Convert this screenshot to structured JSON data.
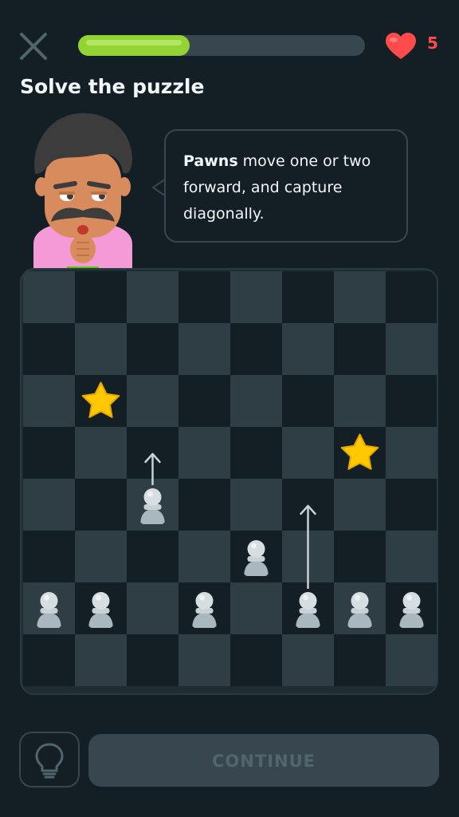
{
  "header": {
    "close_icon": "close-icon",
    "progress_percent": 39,
    "hearts_count": "5",
    "heart_color": "#ff4b4b",
    "progress_color": "#93d333"
  },
  "title": "Solve the puzzle",
  "bubble": {
    "bold_word": "Pawns",
    "text": " move one or two forward, and capture diagonally."
  },
  "board": {
    "light_color": "#2f3e44",
    "dark_color": "#131f24",
    "stars": [
      {
        "file": 1,
        "rank": 2
      },
      {
        "file": 6,
        "rank": 3
      }
    ],
    "pawns": [
      {
        "file": 2,
        "rank": 4
      },
      {
        "file": 4,
        "rank": 5
      },
      {
        "file": 0,
        "rank": 6
      },
      {
        "file": 1,
        "rank": 6
      },
      {
        "file": 3,
        "rank": 6
      },
      {
        "file": 5,
        "rank": 6
      },
      {
        "file": 6,
        "rank": 6
      },
      {
        "file": 7,
        "rank": 6
      }
    ],
    "arrows": [
      {
        "file": 2,
        "from_rank": 4,
        "to_rank": 3
      },
      {
        "file": 5,
        "from_rank": 6,
        "to_rank": 4
      }
    ]
  },
  "footer": {
    "hint_icon": "lightbulb-icon",
    "continue_label": "CONTINUE"
  }
}
